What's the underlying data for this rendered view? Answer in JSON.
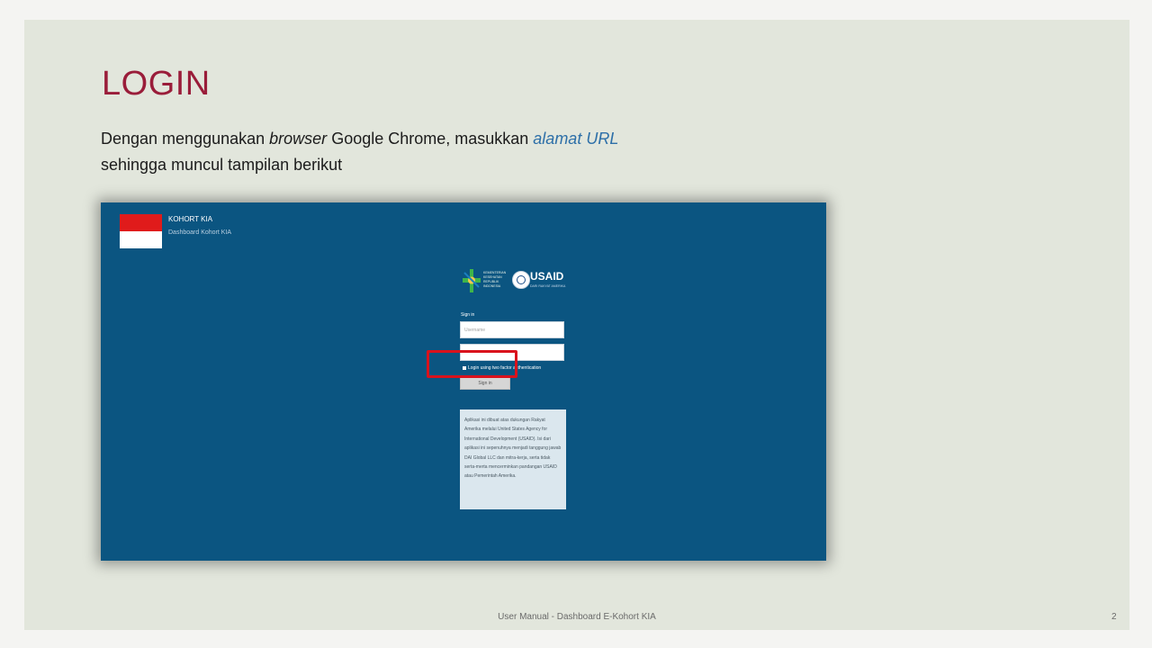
{
  "slide": {
    "title": "LOGIN",
    "intro": {
      "part1": "Dengan menggunakan ",
      "browser": "browser",
      "part2": " Google Chrome, masukkan ",
      "link": "alamat URL",
      "line2": "sehingga muncul tampilan berikut"
    },
    "footer": "User Manual - Dashboard E-Kohort KIA",
    "page_number": "2"
  },
  "login_screen": {
    "app_title": "KOHORT KIA",
    "app_subtitle": "Dashboard Kohort KIA",
    "logo_usaid": "USAID",
    "logo_usaid_sub": "DARI RAKYAT AMERIKA",
    "logo_kemenkes": "KEMENTERIAN KESEHATAN REPUBLIK INDONESIA",
    "signin_label": "Sign in",
    "username_placeholder": "Username",
    "password_placeholder": "",
    "twofa_label": "Login using two factor authentication",
    "signin_button": "Sign in",
    "disclaimer": "Aplikasi ini dibuat atas dukungan Rakyat Amerika melalui United States Agency for International Development (USAID). Isi dari aplikasi ini sepenuhnya menjadi tanggung jawab DAI Global LLC dan mitra-kerja, serta tidak serta-merta mencerminkan pandangan USAID atau Pemerintah Amerika."
  },
  "colors": {
    "title": "#9a1d3a",
    "slide_bg": "#e2e6dc",
    "login_bg": "#0b5581",
    "highlight": "#d9121c",
    "link": "#2d6fa8"
  }
}
